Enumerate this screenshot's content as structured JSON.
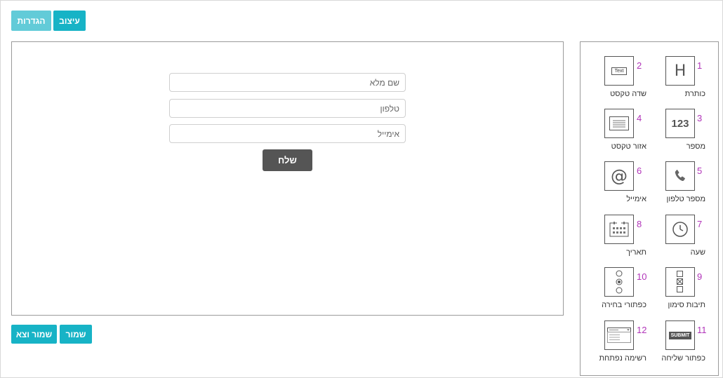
{
  "tabs": {
    "settings": "הגדרות",
    "design": "עיצוב"
  },
  "form": {
    "fields": [
      {
        "placeholder": "שם מלא"
      },
      {
        "placeholder": "טלפון"
      },
      {
        "placeholder": "אימייל"
      }
    ],
    "submit_label": "שלח"
  },
  "actions": {
    "save": "שמור",
    "save_exit": "שמור וצא"
  },
  "palette": [
    {
      "num": "1",
      "label": "כותרת",
      "icon": "heading-icon"
    },
    {
      "num": "2",
      "label": "שדה טקסט",
      "icon": "text-field-icon",
      "icon_text": "Text"
    },
    {
      "num": "3",
      "label": "מספר",
      "icon": "number-icon",
      "icon_text": "123"
    },
    {
      "num": "4",
      "label": "אזור טקסט",
      "icon": "textarea-icon"
    },
    {
      "num": "5",
      "label": "מספר טלפון",
      "icon": "phone-icon"
    },
    {
      "num": "6",
      "label": "אימייל",
      "icon": "at-icon",
      "icon_text": "@"
    },
    {
      "num": "7",
      "label": "שעה",
      "icon": "clock-icon"
    },
    {
      "num": "8",
      "label": "תאריך",
      "icon": "calendar-icon"
    },
    {
      "num": "9",
      "label": "תיבות סימון",
      "icon": "checkboxes-icon"
    },
    {
      "num": "10",
      "label": "כפתורי בחירה",
      "icon": "radio-buttons-icon"
    },
    {
      "num": "11",
      "label": "כפתור שליחה",
      "icon": "submit-button-icon",
      "icon_text": "SUBMIT"
    },
    {
      "num": "12",
      "label": "רשימה נפתחת",
      "icon": "dropdown-icon"
    }
  ],
  "colors": {
    "accent": "#17b3c6",
    "accent_light": "#62cbd8",
    "number": "#b134b9",
    "submit": "#555555"
  }
}
